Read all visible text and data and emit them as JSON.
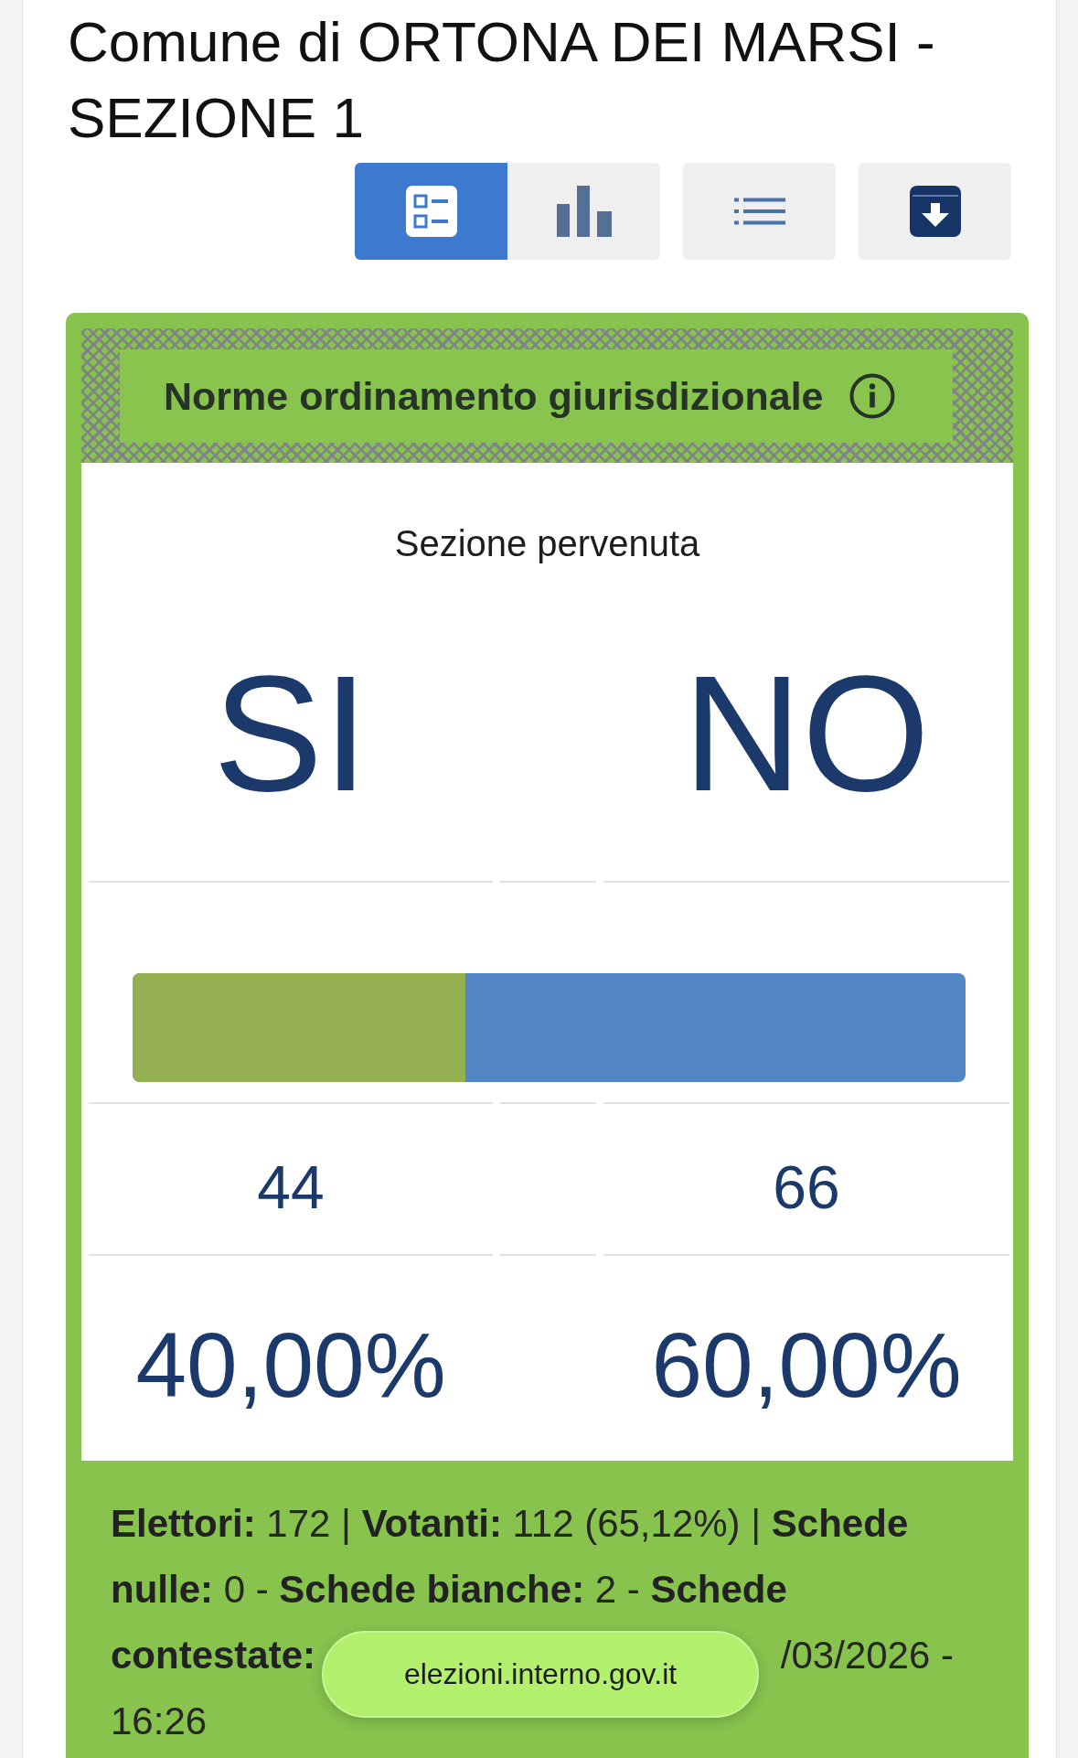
{
  "title": "Comune di ORTONA DEI MARSI - SEZIONE 1",
  "view_toggle": [
    {
      "kind": "summary",
      "selected": true
    },
    {
      "kind": "chart",
      "selected": false
    }
  ],
  "actions": [
    {
      "kind": "list"
    },
    {
      "kind": "download"
    }
  ],
  "referendum": {
    "title": "Norme ordinamento giurisdizionale",
    "status": "Sezione pervenuta",
    "options": [
      {
        "label": "SI",
        "votes": "44",
        "percent": "40,00%"
      },
      {
        "label": "NO",
        "votes": "66",
        "percent": "60,00%"
      }
    ],
    "yes_share": {
      "level": 0.4
    }
  },
  "stats": {
    "text": "**Elettori:** 172 | **Votanti:** 112 (65,12%) | **Schede nulle:** 0 - **Schede bianche:** 2 - **Schede**",
    "label_before_overlay": "contestate:",
    "text_after_overlay": "/03/2026 -",
    "last_line": "16:26"
  },
  "browser": {
    "url": "elezioni.interno.gov.it"
  }
}
